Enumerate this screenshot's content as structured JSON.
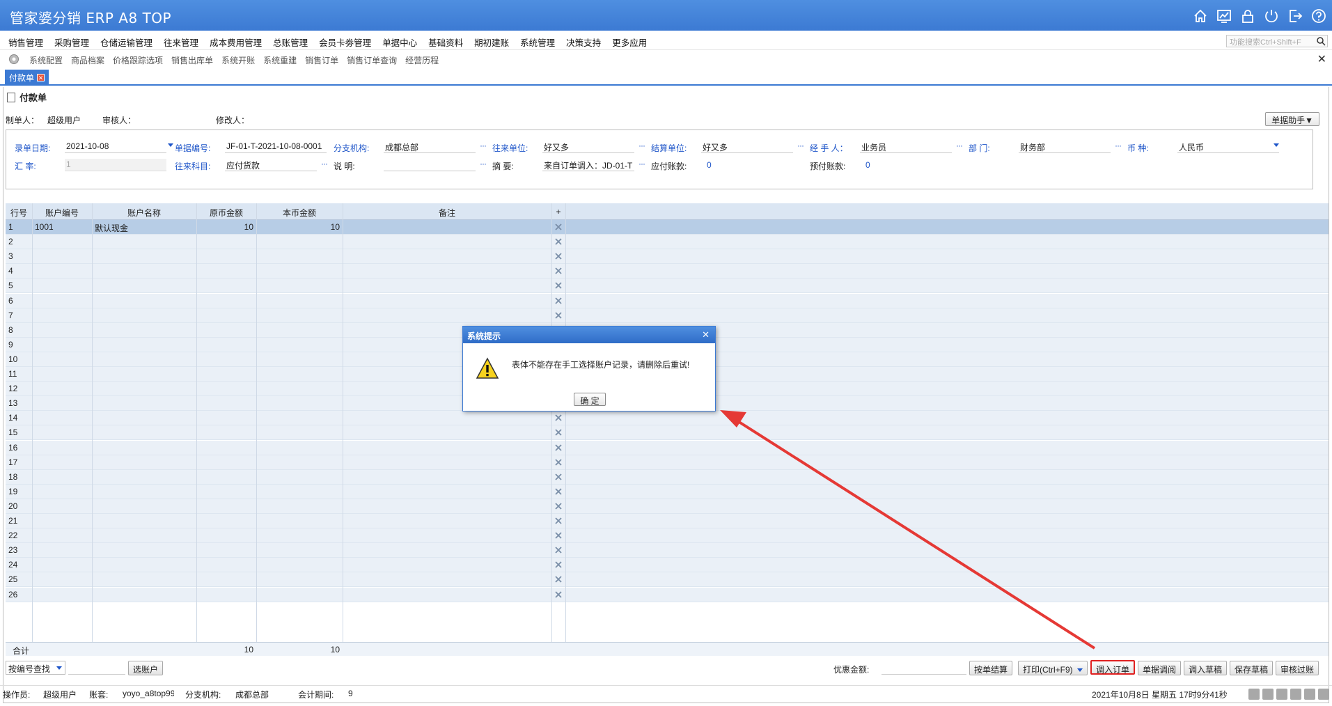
{
  "app": {
    "title": "管家婆分销 ERP A8 TOP"
  },
  "menu": [
    "销售管理",
    "采购管理",
    "仓储运输管理",
    "往来管理",
    "成本费用管理",
    "总账管理",
    "会员卡劵管理",
    "单据中心",
    "基础资料",
    "期初建账",
    "系统管理",
    "决策支持",
    "更多应用"
  ],
  "function_search": {
    "placeholder": "功能搜索Ctrl+Shift+F"
  },
  "quick_links": [
    "系统配置",
    "商品档案",
    "价格跟踪选项",
    "销售出库单",
    "系统开账",
    "系统重建",
    "销售订单",
    "销售订单查询",
    "经营历程"
  ],
  "tab": {
    "label": "付款单"
  },
  "form": {
    "title": "付款单",
    "maker_label": "制单人：",
    "maker": "超级用户",
    "auditor_label": "审核人：",
    "auditor": "",
    "modifier_label": "修改人：",
    "modifier": "",
    "helper_button": "单据助手▼",
    "fields": {
      "date_label": "录单日期:",
      "date": "2021-10-08",
      "docno_label": "单据编号:",
      "docno": "JF-01-T-2021-10-08-0001",
      "branch_label": "分支机构:",
      "branch": "成都总部",
      "partner_label": "往来单位:",
      "partner": "好又多",
      "settle_label": "结算单位:",
      "settle": "好又多",
      "handler_label": "经 手 人：",
      "handler": "业务员",
      "dept_label": "部    门:",
      "dept": "财务部",
      "currency_label": "币    种:",
      "currency": "人民币",
      "rate_label": "汇    率:",
      "rate": "1",
      "subject_label": "往来科目:",
      "subject": "应付货款",
      "remark_label": "说    明:",
      "remark": "",
      "summary_label": "摘    要:",
      "summary": "来自订单调入：JD-01-T",
      "payable_label": "应付账款:",
      "payable": "0",
      "prepay_label": "预付账款:",
      "prepay": "0"
    }
  },
  "grid": {
    "columns": [
      "行号",
      "账户编号",
      "账户名称",
      "原币金额",
      "本币金额",
      "备注",
      "+"
    ],
    "rows": [
      {
        "no": "1",
        "code": "1001",
        "name": "默认现金",
        "orig": "10",
        "local": "10",
        "note": ""
      },
      {
        "no": "2"
      },
      {
        "no": "3"
      },
      {
        "no": "4"
      },
      {
        "no": "5"
      },
      {
        "no": "6"
      },
      {
        "no": "7"
      },
      {
        "no": "8"
      },
      {
        "no": "9"
      },
      {
        "no": "10"
      },
      {
        "no": "11"
      },
      {
        "no": "12"
      },
      {
        "no": "13"
      },
      {
        "no": "14"
      },
      {
        "no": "15"
      },
      {
        "no": "16"
      },
      {
        "no": "17"
      },
      {
        "no": "18"
      },
      {
        "no": "19"
      },
      {
        "no": "20"
      },
      {
        "no": "21"
      },
      {
        "no": "22"
      },
      {
        "no": "23"
      },
      {
        "no": "24"
      },
      {
        "no": "25"
      },
      {
        "no": "26"
      }
    ],
    "total_label": "合计",
    "total_orig": "10",
    "total_local": "10"
  },
  "toolbar": {
    "search_mode": "按编号查找",
    "select_account": "选账户",
    "discount_label": "优惠金额:",
    "buttons": [
      "按单结算",
      "打印(Ctrl+F9)",
      "调入订单",
      "单据调阅",
      "调入草稿",
      "保存草稿",
      "审核过账"
    ]
  },
  "status": {
    "operator_label": "操作员:",
    "operator": "超级用户",
    "book_label": "账套:",
    "book": "yoyo_a8top99",
    "branch_label": "分支机构:",
    "branch": "成都总部",
    "period_label": "会计期间:",
    "period": "9",
    "datetime": "2021年10月8日  星期五   17时9分41秒"
  },
  "dialog": {
    "title": "系统提示",
    "message": "表体不能存在手工选择账户记录，请删除后重试!",
    "ok": "确  定"
  },
  "colors": {
    "titlebar": "#3c7ad3",
    "label_blue": "#1f56c9",
    "selected_row": "#b7cde6",
    "highlight_border": "#e02020",
    "arrow": "#e53935"
  }
}
